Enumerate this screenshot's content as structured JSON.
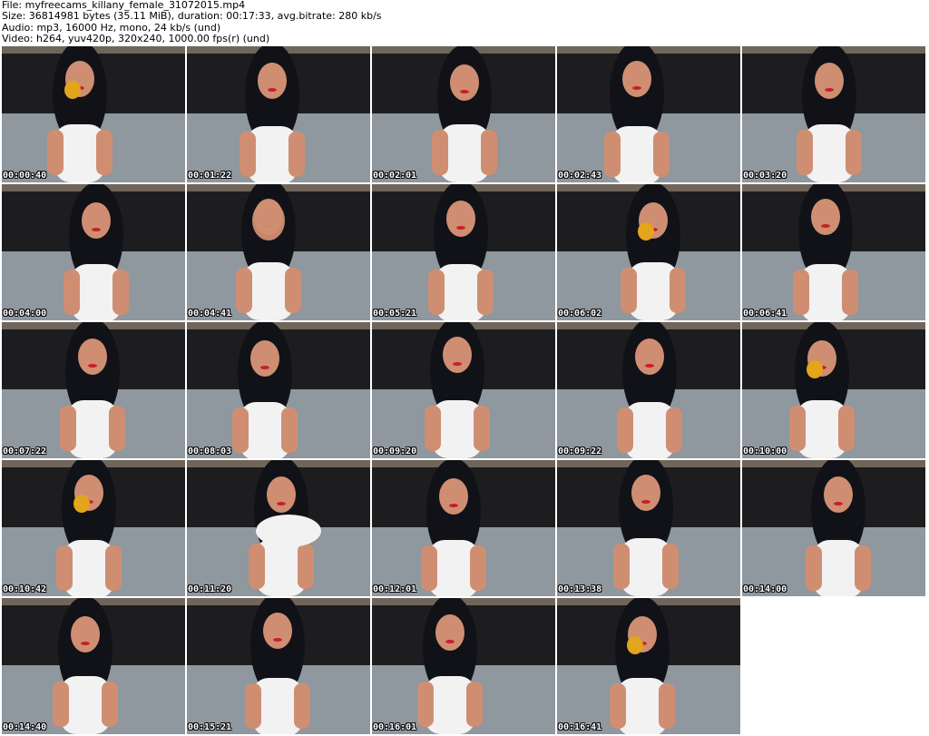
{
  "header": {
    "file": "File: myfreecams_killany_female_31072015.mp4",
    "size": "Size: 36814981 bytes (35.11 MiB), duration: 00:17:33, avg.bitrate: 280 kb/s",
    "audio": "Audio: mp3, 16000 Hz, mono, 24 kb/s (und)",
    "video": "Video: h264, yuv420p, 320x240, 1000.00 fps(r) (und)"
  },
  "thumbnails": [
    {
      "timestamp": "00:00:40",
      "content": "fruit"
    },
    {
      "timestamp": "00:01:22",
      "content": "person"
    },
    {
      "timestamp": "00:02:01",
      "content": "person"
    },
    {
      "timestamp": "00:02:43",
      "content": "person"
    },
    {
      "timestamp": "00:03:20",
      "content": "person"
    },
    {
      "timestamp": "00:04:00",
      "content": "person"
    },
    {
      "timestamp": "00:04:41",
      "content": "hand"
    },
    {
      "timestamp": "00:05:21",
      "content": "person"
    },
    {
      "timestamp": "00:06:02",
      "content": "fruit"
    },
    {
      "timestamp": "00:06:41",
      "content": "person"
    },
    {
      "timestamp": "00:07:22",
      "content": "person"
    },
    {
      "timestamp": "00:08:03",
      "content": "person"
    },
    {
      "timestamp": "00:09:20",
      "content": "person"
    },
    {
      "timestamp": "00:09:22",
      "content": "person"
    },
    {
      "timestamp": "00:10:00",
      "content": "fruit"
    },
    {
      "timestamp": "00:10:42",
      "content": "fruit"
    },
    {
      "timestamp": "00:11:20",
      "content": "leaning"
    },
    {
      "timestamp": "00:12:01",
      "content": "person"
    },
    {
      "timestamp": "00:13:38",
      "content": "person"
    },
    {
      "timestamp": "00:14:00",
      "content": "person"
    },
    {
      "timestamp": "00:14:40",
      "content": "person"
    },
    {
      "timestamp": "00:15:21",
      "content": "person"
    },
    {
      "timestamp": "00:16:01",
      "content": "person"
    },
    {
      "timestamp": "00:16:41",
      "content": "fruit"
    }
  ],
  "colors": {
    "wall": "#70655a",
    "headboard": "#1d1d1f",
    "blanket": "#8f979f",
    "hair": "#111217",
    "skin": "#cf8e72",
    "shirt": "#f2f2f2",
    "lips": "#c81f2b",
    "fruit": "#e2a51c",
    "text": "#000000",
    "timestamp_text": "#ffffff"
  }
}
